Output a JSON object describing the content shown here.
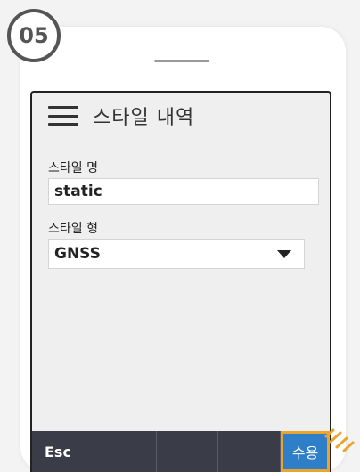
{
  "step_badge": "05",
  "header": {
    "title": "스타일 내역"
  },
  "form": {
    "name_label": "스타일 명",
    "name_value": "static",
    "type_label": "스타일 형",
    "type_value": "GNSS"
  },
  "toolbar": {
    "esc_label": "Esc",
    "accept_label": "수용"
  },
  "icons": {
    "menu": "hamburger-menu-icon",
    "dropdown": "chevron-down-icon",
    "pointer": "tap-hand-icon"
  },
  "colors": {
    "accent": "#2f7fc8",
    "highlight": "#e8a530",
    "toolbar": "#3a3d47"
  }
}
